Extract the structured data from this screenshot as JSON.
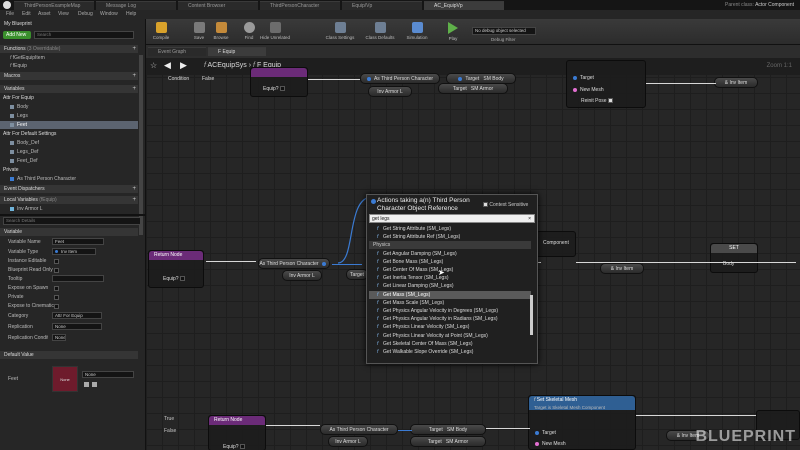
{
  "colors": {
    "accent_blue": "#3b7bd3",
    "return_node": "#6b2b78",
    "target_node": "#2f5f93",
    "exec_white": "#d8d8d8"
  },
  "titlebar": {
    "tabs": [
      "ThirdPersonExampleMap",
      "Message Log",
      "Content Browser",
      "ThirdPersonCharacter",
      "Equip/Vp",
      "AC_EquipVp"
    ],
    "parent_class_label": "Parent class:",
    "parent_class_value": "Actor Component"
  },
  "menubar": {
    "items": [
      "File",
      "Edit",
      "Asset",
      "View",
      "Debug",
      "Window",
      "Help"
    ]
  },
  "toolbar": {
    "buttons": [
      "Compile",
      "Save",
      "Browse",
      "Find",
      "Hide Unrelated",
      "Class Settings",
      "Class Defaults",
      "Simulation",
      "Play"
    ],
    "debug_filter_value": "No debug object selected",
    "debug_filter_label": "Debug Filter"
  },
  "my_blueprint": {
    "tab_title": "My Blueprint",
    "add_new": "Add New",
    "search_placeholder": "Search",
    "sections": {
      "functions": "Functions",
      "functions_count": "(3 Overridable)",
      "function_items": [
        "fGetEquipItem",
        "fEquip"
      ],
      "macros": "Macros",
      "variables": "Variables",
      "attr_for_equip": "Attr For Equip",
      "attr_items": [
        "Body",
        "Legs",
        "Feet"
      ],
      "attr_default": "Attr For Default Settings",
      "default_items": [
        "Body_Def",
        "Legs_Def",
        "Feet_Def"
      ],
      "private": "Private",
      "private_items": [
        "As Third Person Character"
      ],
      "event_dispatchers": "Event Dispatchers",
      "local_variables": "Local Variables",
      "local_hint": "(fEquip)",
      "local_items": [
        "Inv Armor L"
      ]
    }
  },
  "details": {
    "search_placeholder": "Search Details",
    "variable_header": "Variable",
    "fields": [
      {
        "label": "Variable Name",
        "value": "Feet"
      },
      {
        "label": "Variable Type",
        "value": "Inv Item"
      },
      {
        "label": "Instance Editable",
        "value": ""
      },
      {
        "label": "Blueprint Read Only",
        "value": ""
      },
      {
        "label": "Tooltip",
        "value": ""
      },
      {
        "label": "Expose on Spawn",
        "value": ""
      },
      {
        "label": "Private",
        "value": ""
      },
      {
        "label": "Expose to Cinematics",
        "value": ""
      },
      {
        "label": "Category",
        "value": "Attr For Equip"
      },
      {
        "label": "Replication",
        "value": "None"
      },
      {
        "label": "Replication Condition",
        "value": "None"
      }
    ],
    "default_value_header": "Default Value",
    "feet_label": "Feet",
    "feet_thumb_text": "None",
    "feet_dropdown": "None"
  },
  "graph": {
    "tabs": [
      "Event Graph",
      "F Equip"
    ],
    "breadcrumb": [
      "ACEquipSys",
      "F Equip"
    ],
    "zoom": "Zoom 1:1",
    "nodes": {
      "condition": "Condition",
      "false1": "False",
      "equip_q": "Equip?",
      "as_tpc": "As Third Person Character",
      "inv_armor_l": "Inv Armor L",
      "target": "Target",
      "sm_body": "SM Body",
      "sm_armor": "SM Armor",
      "target2": "Target",
      "new_mesh": "New Mesh",
      "reinit_pose": "Reinit Pose",
      "inv_item": "& Inv Item",
      "return_node": "Return Node",
      "set": "SET",
      "body": "Body",
      "component": "Component",
      "true_lbl": "True",
      "false_lbl": "False",
      "sm_body2": "SM Body",
      "set_skel": "Set Skeletal Mesh",
      "set_skel_sub": "Target is Skeletal Mesh Component",
      "target3": "Target",
      "new_mesh2": "New Mesh",
      "inv_item2": "& Inv Item"
    }
  },
  "popup": {
    "title": "Actions taking a(n) Third Person Character Object Reference",
    "context_sensitive": "Context Sensitive",
    "search_value": "get legs",
    "items": [
      {
        "t": "Get String Attribute (SM_Legs)",
        "cat": false,
        "hl": false
      },
      {
        "t": "Get String Attribute Ref (SM_Legs)",
        "cat": false,
        "hl": false
      },
      {
        "t": "Physics",
        "cat": true,
        "hl": false
      },
      {
        "t": "Get Angular Damping (SM_Legs)",
        "cat": false,
        "hl": false
      },
      {
        "t": "Get Bone Mass (SM_Legs)",
        "cat": false,
        "hl": false
      },
      {
        "t": "Get Center Of Mass (SM_Legs)",
        "cat": false,
        "hl": false
      },
      {
        "t": "Get Inertia Tensor (SM_Legs)",
        "cat": false,
        "hl": false
      },
      {
        "t": "Get Linear Damping (SM_Legs)",
        "cat": false,
        "hl": false
      },
      {
        "t": "Get Mass (SM_Legs)",
        "cat": false,
        "hl": true
      },
      {
        "t": "Get Mass Scale (SM_Legs)",
        "cat": false,
        "hl": false
      },
      {
        "t": "Get Physics Angular Velocity in Degrees (SM_Legs)",
        "cat": false,
        "hl": false
      },
      {
        "t": "Get Physics Angular Velocity in Radians (SM_Legs)",
        "cat": false,
        "hl": false
      },
      {
        "t": "Get Physics Linear Velocity (SM_Legs)",
        "cat": false,
        "hl": false
      },
      {
        "t": "Get Physics Linear Velocity at Point (SM_Legs)",
        "cat": false,
        "hl": false
      },
      {
        "t": "Get Skeletal Center Of Mass (SM_Legs)",
        "cat": false,
        "hl": false
      },
      {
        "t": "Get Walkable Slope Override (SM_Legs)",
        "cat": false,
        "hl": false
      }
    ]
  },
  "watermark": "BLUEPRINT"
}
